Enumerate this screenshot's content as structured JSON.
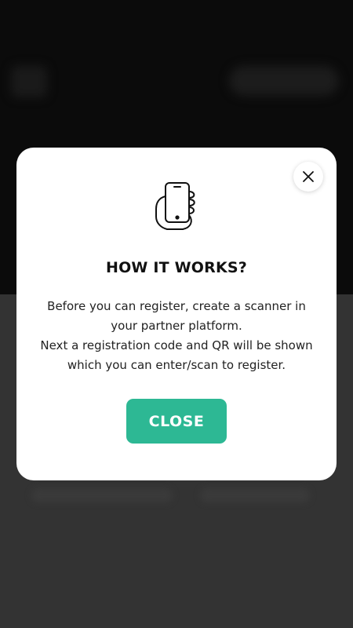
{
  "colors": {
    "accent": "#2db894",
    "overlay_top": "#0b0b0b",
    "overlay_bottom": "#333333",
    "modal_bg": "#ffffff",
    "text": "#222222"
  },
  "modal": {
    "icon": "hand-holding-phone-icon",
    "close_icon": "close-icon",
    "title": "HOW IT WORKS?",
    "body_lines": [
      "Before you can register, create a scanner in",
      "your partner platform.",
      "Next a registration code and QR will be shown",
      "which you can enter/scan to register."
    ],
    "close_button_label": "CLOSE"
  }
}
